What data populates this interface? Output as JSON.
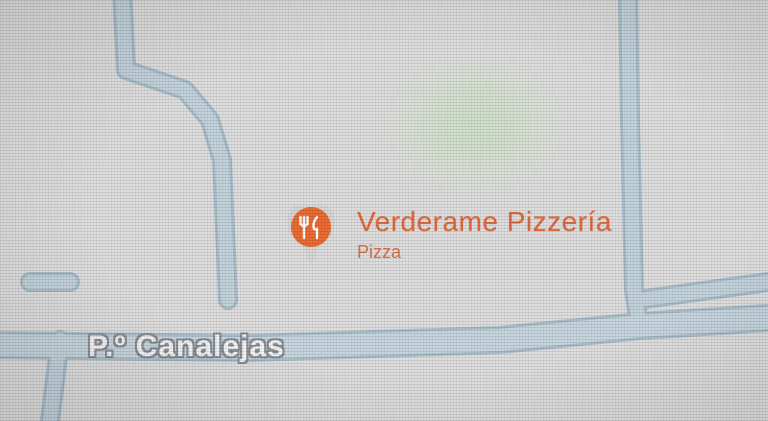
{
  "map": {
    "poi": {
      "name": "Verderame Pizzería",
      "category": "Pizza",
      "icon": "restaurant-icon",
      "color": "#e06a3e"
    },
    "street_label": "P.º Canalejas",
    "colors": {
      "land": "#dedede",
      "road": "#c3d3dc",
      "road_outline": "#a9bdc9",
      "park": "#cfe0c8"
    }
  }
}
